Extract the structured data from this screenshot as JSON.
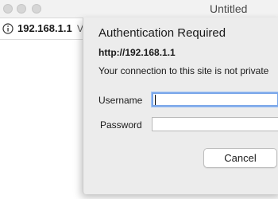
{
  "window": {
    "title": "Untitled"
  },
  "address_bar": {
    "icon": "info-circle-icon",
    "url": "192.168.1.1",
    "trailing_fragment": "V"
  },
  "auth_dialog": {
    "title": "Authentication Required",
    "site": "http://192.168.1.1",
    "message": "Your connection to this site is not private",
    "username_label": "Username",
    "username_value": "",
    "password_label": "Password",
    "password_value": "",
    "cancel_label": "Cancel"
  },
  "colors": {
    "focus_ring": "#7aa7e9",
    "dialog_bg": "#ececec"
  }
}
